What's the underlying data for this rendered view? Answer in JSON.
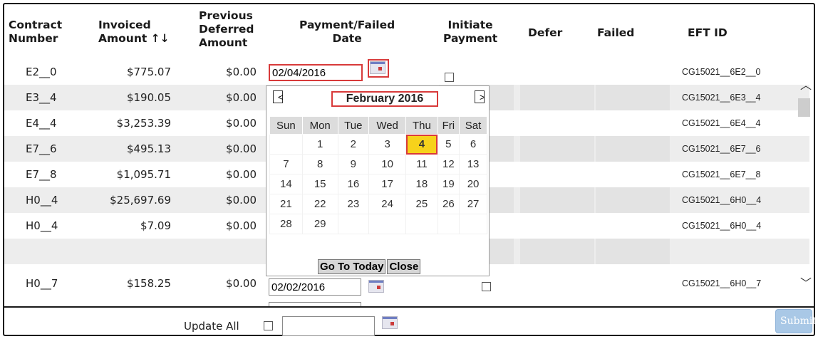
{
  "headers": {
    "contract_number": [
      "Contract",
      "Number"
    ],
    "invoiced_amount": [
      "Invoiced",
      "Amount ↑↓"
    ],
    "prev_deferred": [
      "Previous",
      "Deferred",
      "Amount"
    ],
    "payment_failed_date": [
      "Payment/Failed",
      "Date"
    ],
    "initiate_payment": [
      "Initiate",
      "Payment"
    ],
    "defer": "Defer",
    "failed": "Failed",
    "eft_id": "EFT ID"
  },
  "rows": [
    {
      "contract": "E2__0",
      "invoiced": "$775.07",
      "deferred": "$0.00",
      "date": "02/04/2016",
      "eft": "CG15021__6E2__0"
    },
    {
      "contract": "E3__4",
      "invoiced": "$190.05",
      "deferred": "$0.00",
      "date": "",
      "eft": "CG15021__6E3__4"
    },
    {
      "contract": "E4__4",
      "invoiced": "$3,253.39",
      "deferred": "$0.00",
      "date": "",
      "eft": "CG15021__6E4__4"
    },
    {
      "contract": "E7__6",
      "invoiced": "$495.13",
      "deferred": "$0.00",
      "date": "",
      "eft": "CG15021__6E7__6"
    },
    {
      "contract": "E7__8",
      "invoiced": "$1,095.71",
      "deferred": "$0.00",
      "date": "",
      "eft": "CG15021__6E7__8"
    },
    {
      "contract": "H0__4",
      "invoiced": "$25,697.69",
      "deferred": "$0.00",
      "date": "",
      "eft": "CG15021__6H0__4"
    },
    {
      "contract": "H0__4",
      "invoiced": "$7.09",
      "deferred": "$0.00",
      "date": "",
      "eft": "CG15021__6H0__4"
    },
    {
      "contract": "H0__7",
      "invoiced": "$158.25",
      "deferred": "$0.00",
      "date": "02/02/2016",
      "eft": "CG15021__6H0__7"
    }
  ],
  "calendar": {
    "prev": "<",
    "next": ">",
    "month_title": "February 2016",
    "weekdays": [
      "Sun",
      "Mon",
      "Tue",
      "Wed",
      "Thu",
      "Fri",
      "Sat"
    ],
    "weeks": [
      [
        "",
        "1",
        "2",
        "3",
        "4",
        "5",
        "6"
      ],
      [
        "7",
        "8",
        "9",
        "10",
        "11",
        "12",
        "13"
      ],
      [
        "14",
        "15",
        "16",
        "17",
        "18",
        "19",
        "20"
      ],
      [
        "21",
        "22",
        "23",
        "24",
        "25",
        "26",
        "27"
      ],
      [
        "28",
        "29",
        "",
        "",
        "",
        "",
        ""
      ]
    ],
    "selected_day": "4",
    "go_to_today": "Go To Today",
    "close": "Close"
  },
  "footer": {
    "update_all_label": "Update All",
    "update_all_date": "",
    "submit": "Submit"
  },
  "colors": {
    "highlight": "#f7d21b",
    "annotation": "#d83a3a",
    "row_alt": "#ededed",
    "submit_bg": "#a9c8e6"
  }
}
